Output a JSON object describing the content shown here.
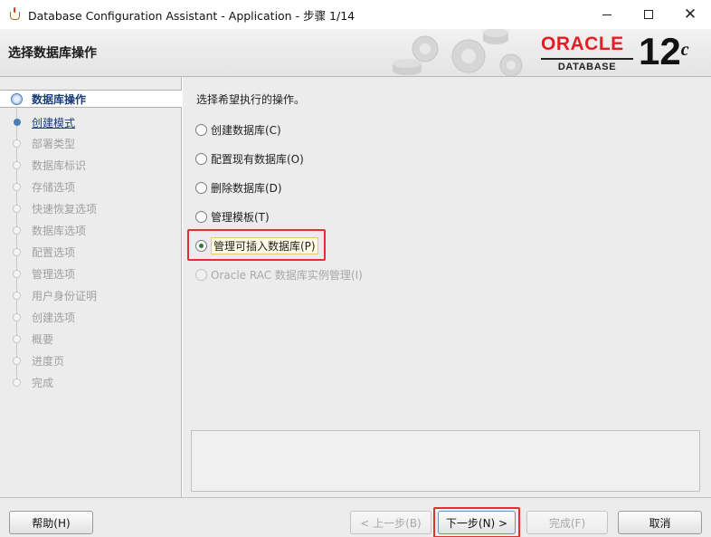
{
  "window": {
    "title": "Database Configuration Assistant - Application - 步骤 1/14"
  },
  "banner": {
    "title": "选择数据库操作",
    "oracle_word": "ORACLE",
    "oracle_sub": "DATABASE",
    "version": "12",
    "version_suffix": "c"
  },
  "nav": {
    "items": [
      {
        "label": "数据库操作",
        "state": "active"
      },
      {
        "label": "创建模式",
        "state": "next"
      },
      {
        "label": "部署类型",
        "state": "disabled"
      },
      {
        "label": "数据库标识",
        "state": "disabled"
      },
      {
        "label": "存储选项",
        "state": "disabled"
      },
      {
        "label": "快速恢复选项",
        "state": "disabled"
      },
      {
        "label": "数据库选项",
        "state": "disabled"
      },
      {
        "label": "配置选项",
        "state": "disabled"
      },
      {
        "label": "管理选项",
        "state": "disabled"
      },
      {
        "label": "用户身份证明",
        "state": "disabled"
      },
      {
        "label": "创建选项",
        "state": "disabled"
      },
      {
        "label": "概要",
        "state": "disabled"
      },
      {
        "label": "进度页",
        "state": "disabled"
      },
      {
        "label": "完成",
        "state": "disabled"
      }
    ]
  },
  "main": {
    "prompt": "选择希望执行的操作。",
    "options": [
      {
        "label": "创建数据库(C)",
        "checked": false,
        "enabled": true
      },
      {
        "label": "配置现有数据库(O)",
        "checked": false,
        "enabled": true
      },
      {
        "label": "删除数据库(D)",
        "checked": false,
        "enabled": true
      },
      {
        "label": "管理模板(T)",
        "checked": false,
        "enabled": true
      },
      {
        "label": "管理可插入数据库(P)",
        "checked": true,
        "enabled": true
      },
      {
        "label": "Oracle RAC 数据库实例管理(I)",
        "checked": false,
        "enabled": false
      }
    ]
  },
  "buttons": {
    "help": "帮助(H)",
    "back": "< 上一步(B)",
    "next": "下一步(N) >",
    "finish": "完成(F)",
    "cancel": "取消"
  },
  "colors": {
    "highlight": "#e03030",
    "oracle_red": "#e41e26",
    "nav_active": "#1a3c78"
  }
}
